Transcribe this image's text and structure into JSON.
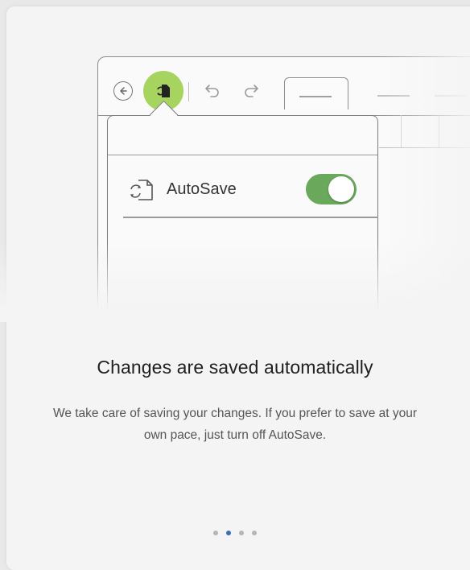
{
  "popover": {
    "autosave_label": "AutoSave",
    "autosave_enabled": true
  },
  "content": {
    "headline": "Changes are saved automatically",
    "body": "We take care of saving your changes. If you prefer to save at your own pace, just turn off AutoSave."
  },
  "pagination": {
    "total": 4,
    "current": 2
  },
  "icons": {
    "back": "back-arrow-icon",
    "autosave": "autosave-icon",
    "undo": "undo-icon",
    "redo": "redo-icon"
  },
  "colors": {
    "autosave_highlight": "#a7d45f",
    "toggle_on": "#6aa85c",
    "active_dot": "#3a6fb7"
  }
}
